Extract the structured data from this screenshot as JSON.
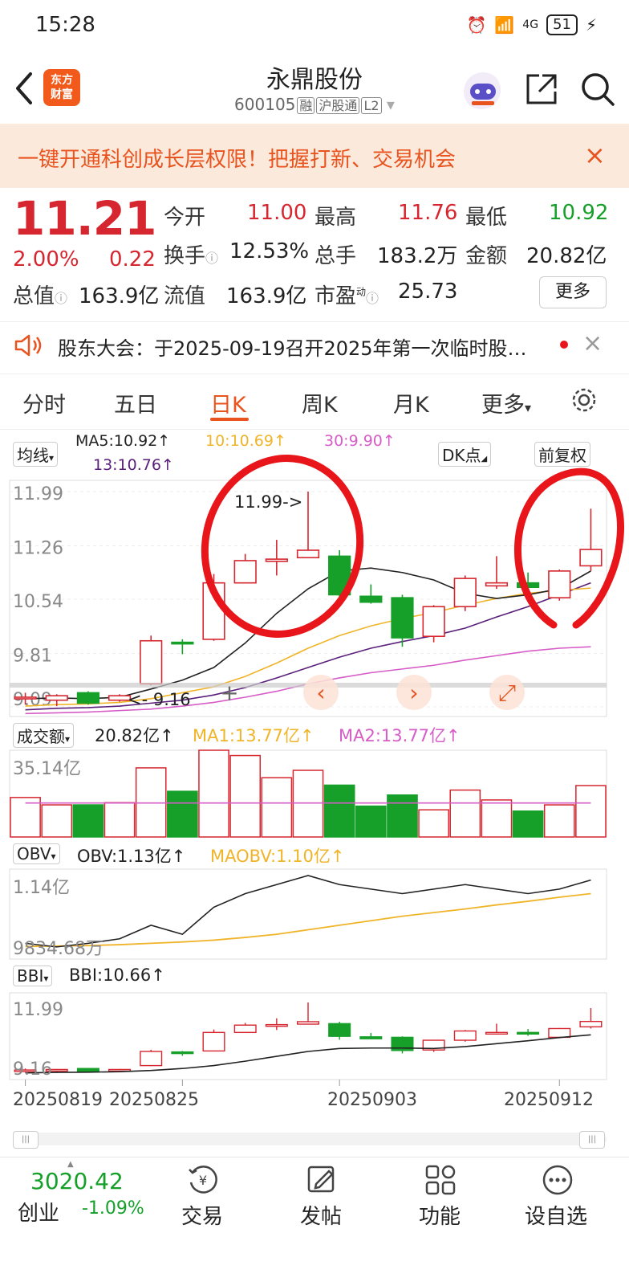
{
  "status": {
    "time": "15:28",
    "battery": "51",
    "network": "4G"
  },
  "header": {
    "name": "永鼎股份",
    "code": "600105",
    "tags": [
      "融",
      "沪股通",
      "L2"
    ],
    "logo": "东方\n财富",
    "back_icon": "back-arrow-icon",
    "share_icon": "share-icon",
    "search_icon": "search-icon"
  },
  "banner": {
    "text": "一键开通科创成长层权限！把握打新、交易机会",
    "close": "×"
  },
  "quote": {
    "price": "11.21",
    "pct": "2.00%",
    "chg": "0.22",
    "open_label": "今开",
    "open": "11.00",
    "high_label": "最高",
    "high": "11.76",
    "low_label": "最低",
    "low": "10.92",
    "turnover_label": "换手",
    "turnover": "12.53%",
    "volume_label": "总手",
    "volume": "183.2万",
    "amount_label": "金额",
    "amount": "20.82亿",
    "mcap_label": "总值",
    "mcap": "163.9亿",
    "float_label": "流值",
    "float": "163.9亿",
    "pe_label": "市盈",
    "pe_sup": "动",
    "pe": "25.73",
    "more": "更多"
  },
  "notice": {
    "text": "股东大会：于2025-09-19召开2025年第一次临时股…"
  },
  "tabs": {
    "items": [
      "分时",
      "五日",
      "日K",
      "周K",
      "月K",
      "更多"
    ],
    "active": "日K",
    "settings_icon": "gear-icon"
  },
  "chart": {
    "ma_select": "均线",
    "ma5": "MA5:10.92↑",
    "ma10": "10:10.69↑",
    "ma30": "30:9.90↑",
    "ma13": "13:10.76↑",
    "dk": "DK点",
    "adjust": "前复权",
    "price_ticks": [
      "11.99",
      "11.26",
      "10.54",
      "9.81",
      "9.09"
    ],
    "high_annotation": "11.99->",
    "low_annotation": "<- 9.16",
    "vol_select": "成交额",
    "vol_value": "20.82亿↑",
    "vol_ma1": "MA1:13.77亿↑",
    "vol_ma2": "MA2:13.77亿↑",
    "vol_tick": "35.14亿",
    "obv_select": "OBV",
    "obv_value": "OBV:1.13亿↑",
    "maobv_value": "MAOBV:1.10亿↑",
    "obv_top": "1.14亿",
    "obv_bottom": "9834.68万",
    "bbi_select": "BBI",
    "bbi_value": "BBI:10.66↑",
    "bbi_top": "11.99",
    "bbi_bottom": "9.16",
    "dates": [
      "20250819",
      "20250825",
      "20250903",
      "20250912"
    ]
  },
  "colors": {
    "up": "#d6262f",
    "down": "#16a02a",
    "accent": "#e8531e",
    "ma5": "#222222",
    "ma10": "#f0b429",
    "ma13": "#5a1f7a",
    "ma30": "#d65cc7",
    "annotation": "#e8151a"
  },
  "chart_data": {
    "type": "candlestick",
    "candles": [
      {
        "o": 9.2,
        "h": 9.28,
        "l": 9.12,
        "c": 9.22
      },
      {
        "o": 9.18,
        "h": 9.26,
        "l": 9.1,
        "c": 9.24
      },
      {
        "o": 9.28,
        "h": 9.3,
        "l": 9.12,
        "c": 9.14
      },
      {
        "o": 9.18,
        "h": 9.26,
        "l": 9.16,
        "c": 9.24
      },
      {
        "o": 9.4,
        "h": 10.05,
        "l": 9.38,
        "c": 9.98
      },
      {
        "o": 9.96,
        "h": 10.0,
        "l": 9.8,
        "c": 9.94
      },
      {
        "o": 10.0,
        "h": 10.88,
        "l": 9.98,
        "c": 10.76
      },
      {
        "o": 10.76,
        "h": 11.15,
        "l": 10.76,
        "c": 11.06
      },
      {
        "o": 11.05,
        "h": 11.34,
        "l": 10.86,
        "c": 11.08
      },
      {
        "o": 11.1,
        "h": 11.99,
        "l": 11.1,
        "c": 11.2
      },
      {
        "o": 11.12,
        "h": 11.2,
        "l": 10.46,
        "c": 10.6
      },
      {
        "o": 10.58,
        "h": 10.74,
        "l": 10.48,
        "c": 10.5
      },
      {
        "o": 10.56,
        "h": 10.6,
        "l": 9.9,
        "c": 10.02
      },
      {
        "o": 10.04,
        "h": 10.46,
        "l": 9.96,
        "c": 10.44
      },
      {
        "o": 10.44,
        "h": 10.86,
        "l": 10.38,
        "c": 10.82
      },
      {
        "o": 10.72,
        "h": 11.12,
        "l": 10.68,
        "c": 10.76
      },
      {
        "o": 10.76,
        "h": 10.9,
        "l": 10.62,
        "c": 10.7
      },
      {
        "o": 10.56,
        "h": 10.94,
        "l": 10.52,
        "c": 10.92
      },
      {
        "o": 10.99,
        "h": 11.76,
        "l": 10.92,
        "c": 11.21
      }
    ],
    "ma5": [
      9.2,
      9.21,
      9.2,
      9.22,
      9.33,
      9.45,
      9.62,
      9.95,
      10.35,
      10.68,
      10.92,
      10.96,
      10.9,
      10.8,
      10.62,
      10.55,
      10.6,
      10.68,
      10.92
    ],
    "ma10": [
      9.1,
      9.12,
      9.13,
      9.15,
      9.2,
      9.28,
      9.36,
      9.5,
      9.68,
      9.88,
      10.05,
      10.18,
      10.28,
      10.36,
      10.46,
      10.55,
      10.62,
      10.66,
      10.69
    ],
    "ma13": [
      9.05,
      9.07,
      9.08,
      9.1,
      9.14,
      9.18,
      9.25,
      9.35,
      9.48,
      9.62,
      9.76,
      9.88,
      9.97,
      10.05,
      10.15,
      10.3,
      10.44,
      10.6,
      10.76
    ],
    "ma30": [
      9.0,
      9.01,
      9.02,
      9.04,
      9.06,
      9.1,
      9.15,
      9.22,
      9.3,
      9.4,
      9.48,
      9.55,
      9.6,
      9.65,
      9.72,
      9.78,
      9.84,
      9.88,
      9.9
    ],
    "volume": [
      16.0,
      13.0,
      13.0,
      13.9,
      28.0,
      18.5,
      35.14,
      33.0,
      24.0,
      27.0,
      21.0,
      12.5,
      17.0,
      11.0,
      19.0,
      15.0,
      10.5,
      13.0,
      20.82
    ],
    "volume_ma": [
      13.77,
      13.77,
      13.77,
      13.77,
      13.77,
      13.77,
      13.77,
      13.77,
      13.77,
      13.77,
      13.77,
      13.77,
      13.77,
      13.77,
      13.77,
      13.77,
      13.77,
      13.77,
      13.77
    ],
    "obv": [
      0.99,
      0.982,
      0.99,
      1.0,
      1.03,
      1.01,
      1.07,
      1.1,
      1.12,
      1.14,
      1.12,
      1.11,
      1.1,
      1.11,
      1.12,
      1.11,
      1.1,
      1.11,
      1.13
    ],
    "maobv": [
      0.983,
      0.984,
      0.985,
      0.987,
      0.99,
      0.993,
      0.997,
      1.003,
      1.01,
      1.02,
      1.03,
      1.04,
      1.05,
      1.058,
      1.066,
      1.075,
      1.083,
      1.092,
      1.1
    ],
    "bbi": [
      9.1,
      9.12,
      9.13,
      9.15,
      9.2,
      9.28,
      9.4,
      9.58,
      9.78,
      9.98,
      10.1,
      10.12,
      10.12,
      10.1,
      10.18,
      10.3,
      10.42,
      10.55,
      10.66
    ],
    "date_index": [
      0,
      5,
      10,
      17
    ],
    "ylim": [
      9.09,
      11.99
    ]
  }
}
